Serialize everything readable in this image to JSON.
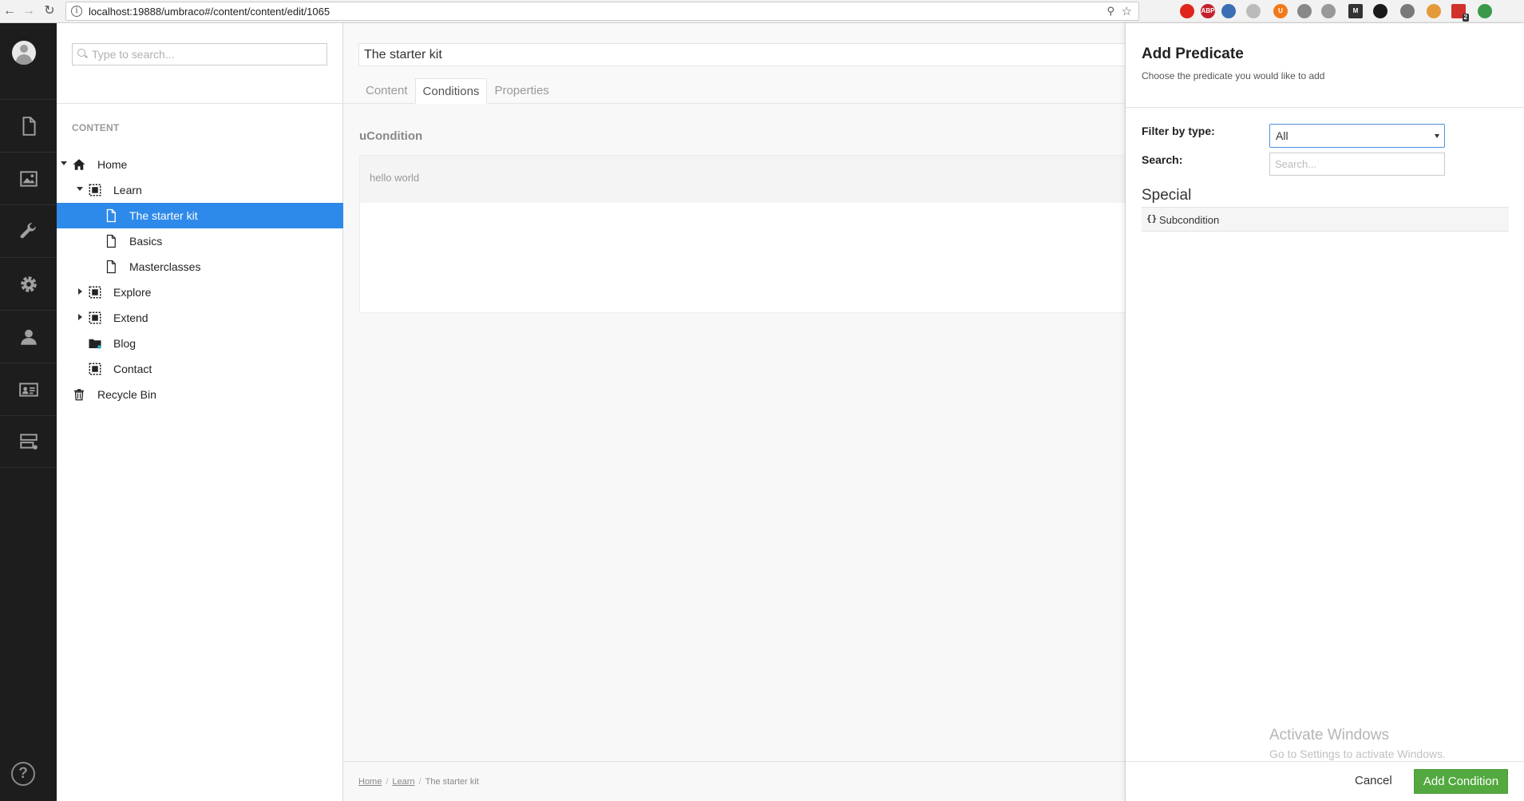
{
  "browser": {
    "url": "localhost:19888/umbraco#/content/content/edit/1065",
    "info_glyph": "i",
    "back_glyph": "←",
    "forward_glyph": "→",
    "reload_glyph": "↻",
    "key_glyph": "⚲",
    "star_glyph": "☆",
    "extensions": [
      {
        "name": "opera-icon",
        "color": "#e0251b"
      },
      {
        "name": "adblock-icon",
        "color": "#c4202a",
        "label": "ABP"
      },
      {
        "name": "screen-icon",
        "color": "#3b6fb4"
      },
      {
        "name": "feather-icon",
        "color": "#bbbbbb"
      },
      {
        "name": "ublock-icon",
        "color": "#f07a1b",
        "label": "U"
      },
      {
        "name": "cloud-gray-icon",
        "color": "#888888"
      },
      {
        "name": "cloud-drive-icon",
        "color": "#999999"
      },
      {
        "name": "m-extension-icon",
        "color": "#333333",
        "label": "M"
      },
      {
        "name": "dark-circle-icon",
        "color": "#1a1a1a"
      },
      {
        "name": "scissors-icon",
        "color": "#7a7a7a"
      },
      {
        "name": "cookie-icon",
        "color": "#e39a3a"
      },
      {
        "name": "calendar-badge-icon",
        "color": "#d0322c",
        "badge": "2"
      },
      {
        "name": "globe-green-icon",
        "color": "#3a9a4a"
      }
    ]
  },
  "tree": {
    "search_placeholder": "Type to search...",
    "heading": "CONTENT",
    "items": [
      {
        "label": "Home"
      },
      {
        "label": "Learn"
      },
      {
        "label": "The starter kit"
      },
      {
        "label": "Basics"
      },
      {
        "label": "Masterclasses"
      },
      {
        "label": "Explore"
      },
      {
        "label": "Extend"
      },
      {
        "label": "Blog"
      },
      {
        "label": "Contact"
      },
      {
        "label": "Recycle Bin"
      }
    ]
  },
  "main": {
    "doc_name": "The starter kit",
    "tabs": [
      {
        "label": "Content"
      },
      {
        "label": "Conditions"
      },
      {
        "label": "Properties"
      }
    ],
    "active_tab": "Conditions",
    "property_label": "uCondition",
    "property_value": "hello world",
    "breadcrumb": [
      {
        "label": "Home"
      },
      {
        "label": "Learn"
      },
      {
        "label": "The starter kit"
      }
    ],
    "breadcrumb_sep": "/"
  },
  "dialog": {
    "title": "Add Predicate",
    "subtitle": "Choose the predicate you would like to add",
    "filter_label": "Filter by type:",
    "filter_value": "All",
    "search_label": "Search:",
    "search_placeholder": "Search...",
    "group_title": "Special",
    "predicate_brace": "{}",
    "predicate_name": "Subcondition",
    "cancel_label": "Cancel",
    "add_label": "Add Condition"
  },
  "watermark": {
    "line1": "Activate Windows",
    "line2": "Go to Settings to activate Windows."
  },
  "help_glyph": "?",
  "colors": {
    "selected": "#2e8aea",
    "primary_button": "#53a93f",
    "sidebar": "#1d1d1d"
  }
}
